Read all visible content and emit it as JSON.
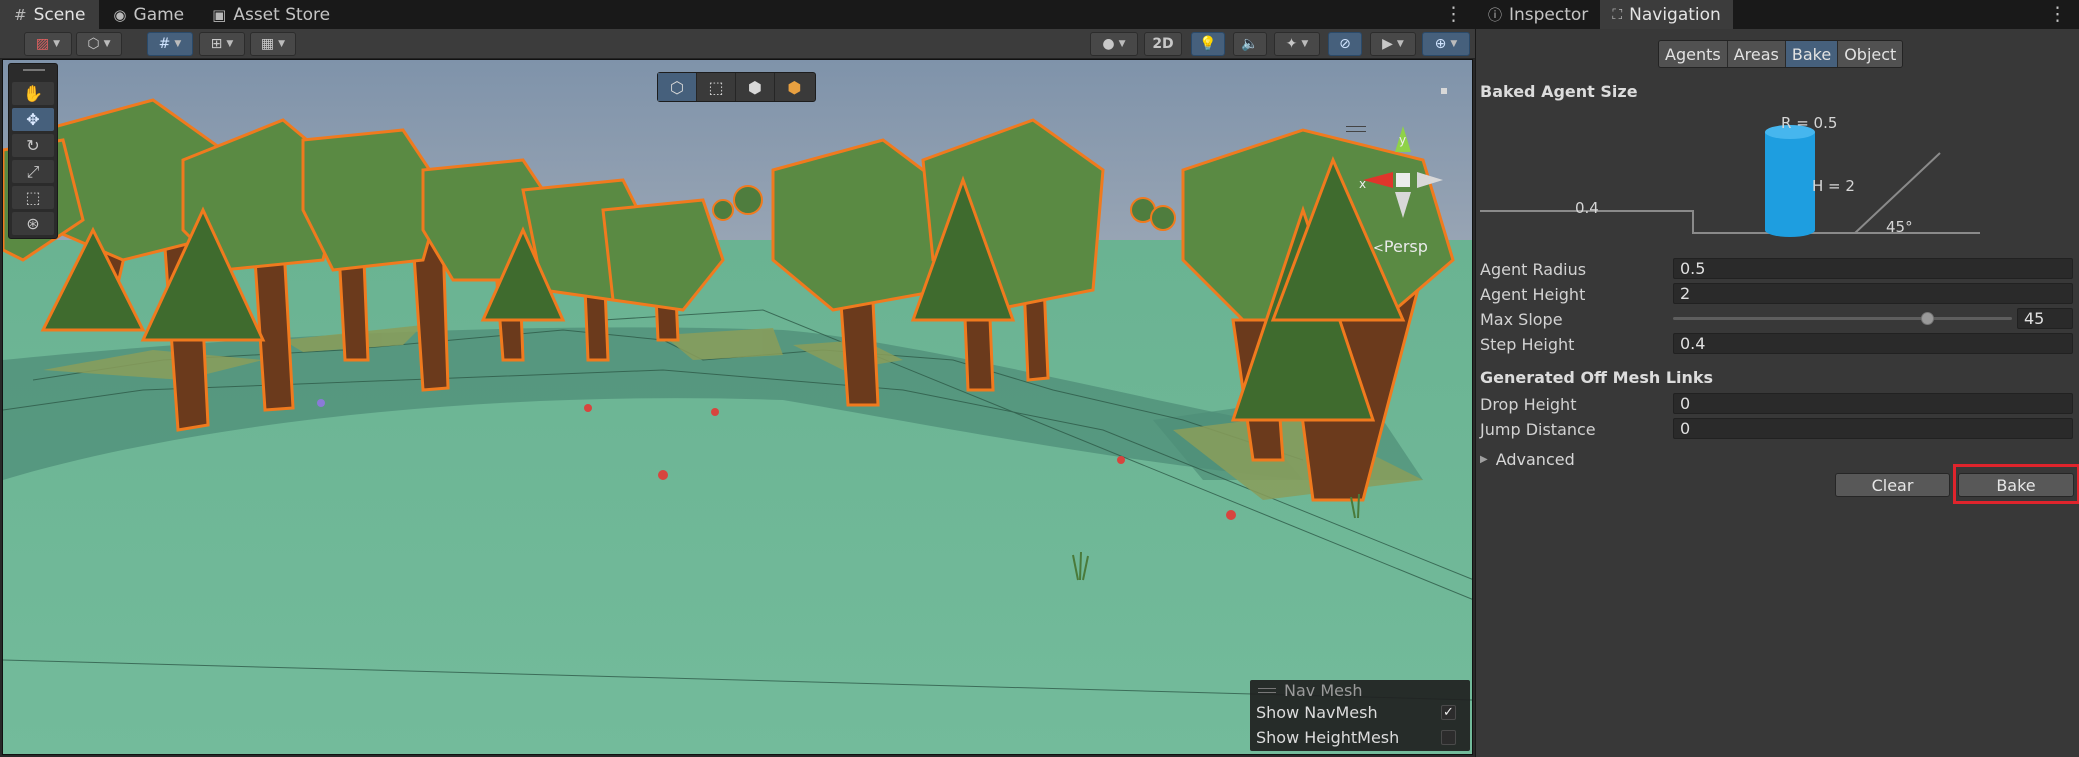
{
  "scene_tabs": [
    {
      "label": "Scene",
      "icon": "grid-icon"
    },
    {
      "label": "Game",
      "icon": "gamepad-icon"
    },
    {
      "label": "Asset Store",
      "icon": "bag-icon"
    }
  ],
  "toolbar": {
    "btn_2d": "2D"
  },
  "viewport": {
    "gizmo_view": "Persp",
    "axis_x": "x",
    "axis_y": "y"
  },
  "navmesh_overlay": {
    "title": "Nav Mesh",
    "show_navmesh_label": "Show NavMesh",
    "show_navmesh_checked": true,
    "show_heightmesh_label": "Show HeightMesh",
    "show_heightmesh_checked": false,
    "check_glyph": "✓"
  },
  "right_tabs": [
    {
      "label": "Inspector",
      "icon": "info-icon"
    },
    {
      "label": "Navigation",
      "icon": "navigation-icon"
    }
  ],
  "nav_tabs": [
    "Agents",
    "Areas",
    "Bake",
    "Object"
  ],
  "nav_active_tab": "Bake",
  "baked_agent_size": {
    "heading": "Baked Agent Size",
    "r_label": "R = 0.5",
    "h_label": "H = 2",
    "step_label": "0.4",
    "slope_label": "45°"
  },
  "properties": {
    "agent_radius": {
      "label": "Agent Radius",
      "value": "0.5"
    },
    "agent_height": {
      "label": "Agent Height",
      "value": "2"
    },
    "max_slope": {
      "label": "Max Slope",
      "value": "45",
      "fraction": 0.75
    },
    "step_height": {
      "label": "Step Height",
      "value": "0.4"
    }
  },
  "off_mesh": {
    "heading": "Generated Off Mesh Links",
    "drop_height": {
      "label": "Drop Height",
      "value": "0"
    },
    "jump_distance": {
      "label": "Jump Distance",
      "value": "0"
    }
  },
  "advanced_label": "Advanced",
  "buttons": {
    "clear": "Clear",
    "bake": "Bake"
  },
  "colors": {
    "accent": "#46607c",
    "highlight": "#e0242c",
    "ground": "#6fb896",
    "selection_outline": "#f07a1e",
    "cylinder": "#1e9ee0"
  }
}
